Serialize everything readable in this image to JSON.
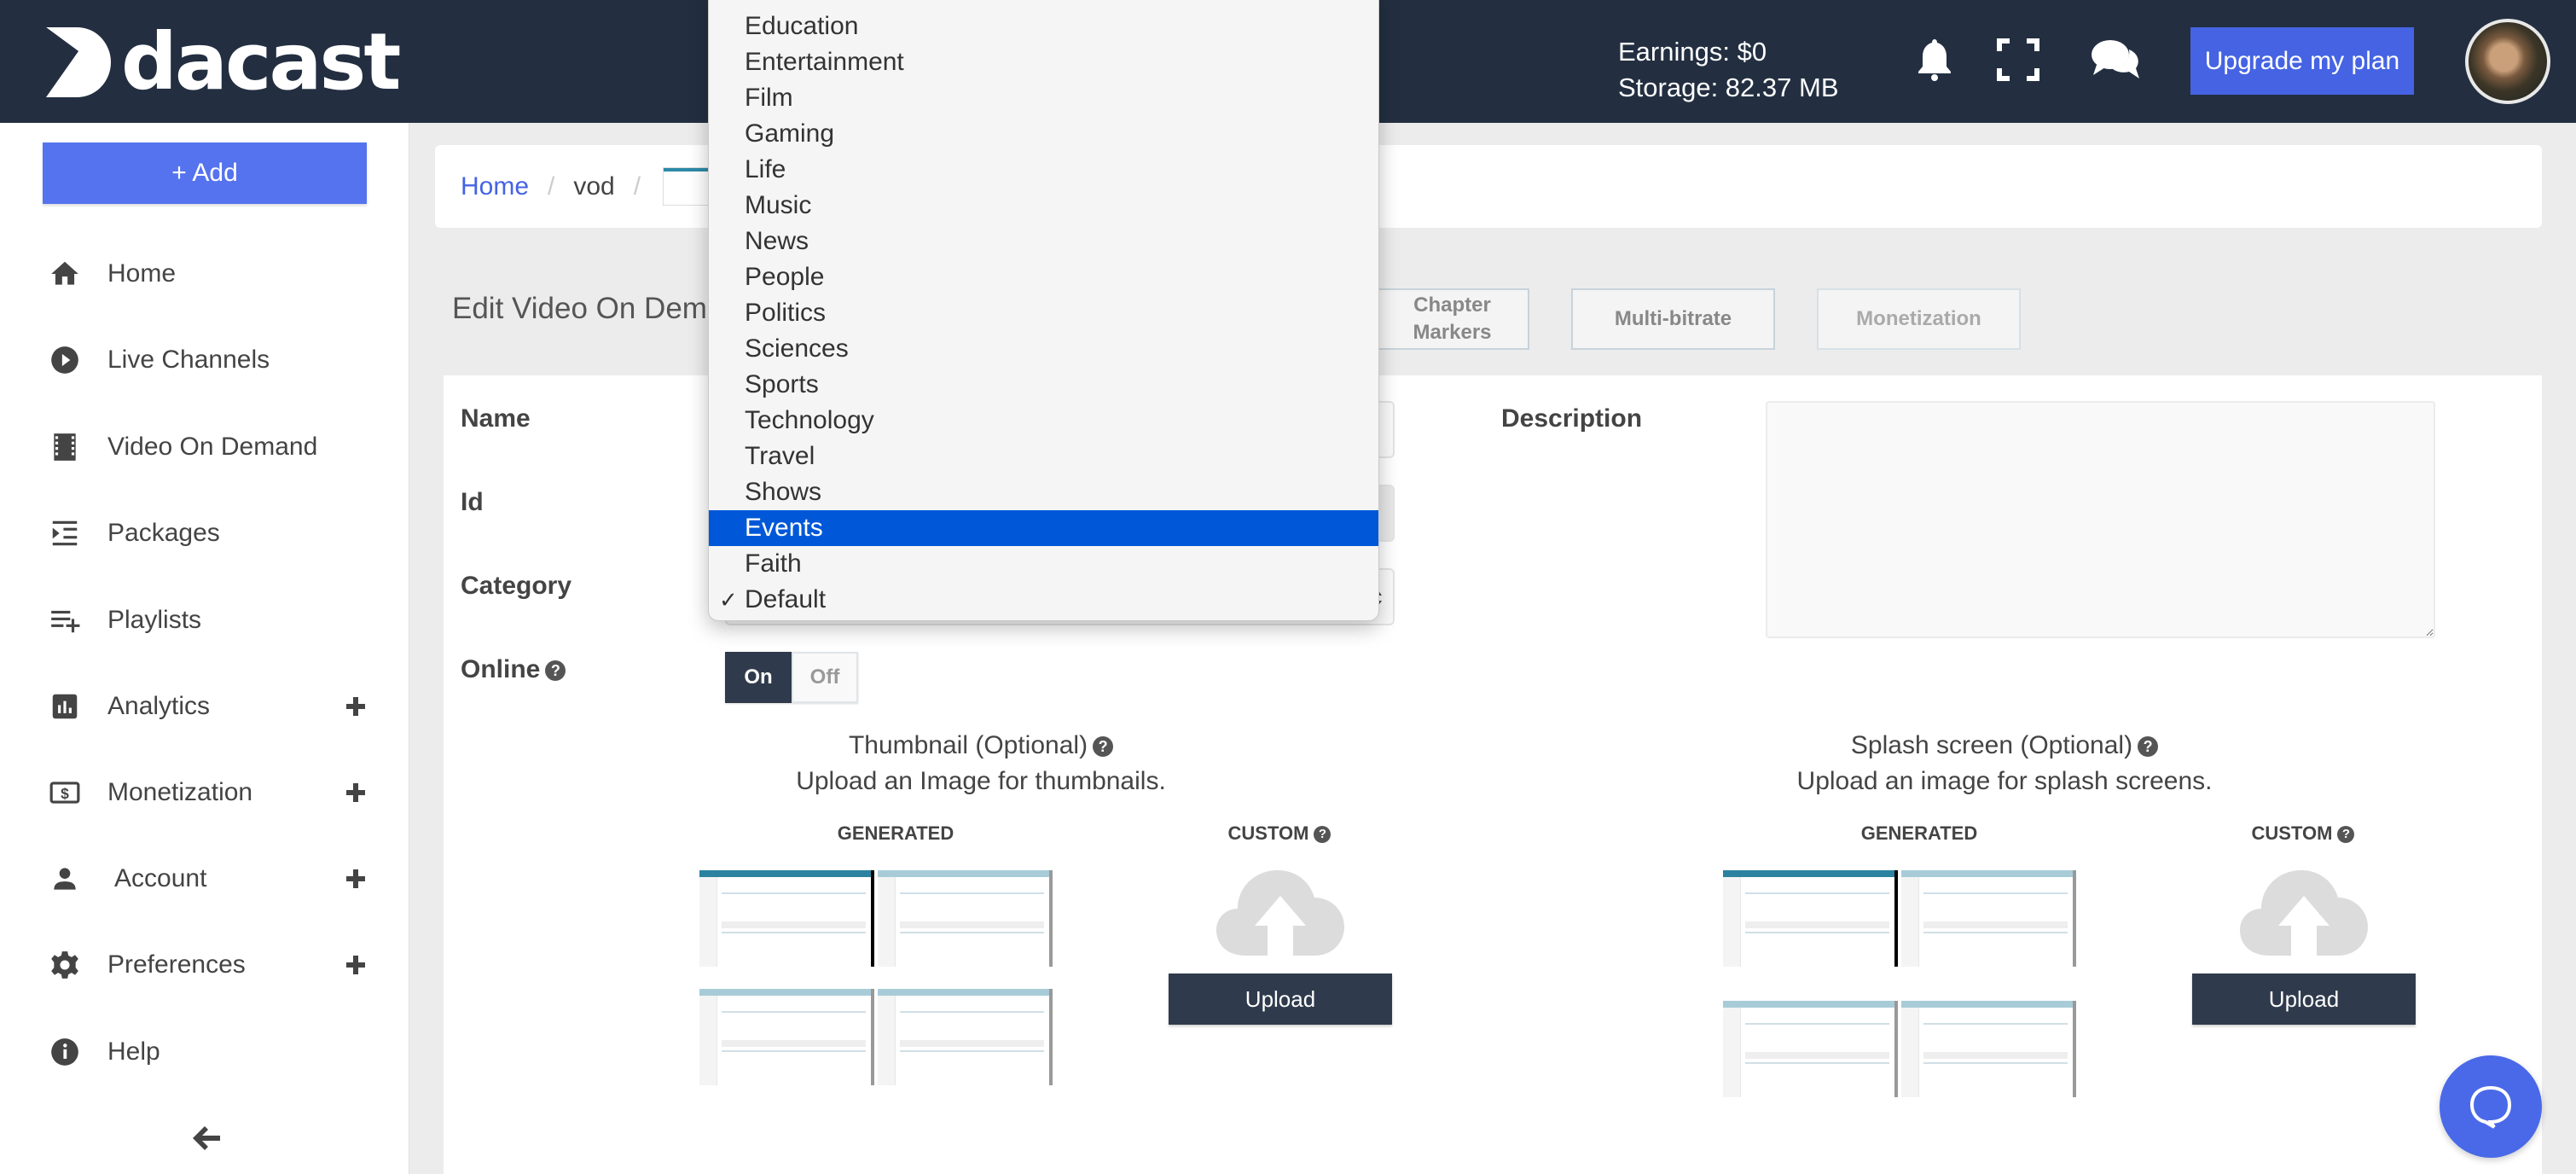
{
  "header": {
    "logo_text": "dacast",
    "earnings": "Earnings: $0",
    "storage": "Storage: 82.37 MB",
    "icons": [
      "bell-icon",
      "fullscreen-icon",
      "chat-icon"
    ],
    "upgrade_label": "Upgrade my plan",
    "colors": {
      "header_bg": "#232f41",
      "upgrade_bg": "#4563e3"
    }
  },
  "sidebar": {
    "add_label": "+ Add",
    "items": [
      {
        "label": "Home",
        "icon": "home-icon",
        "expandable": false
      },
      {
        "label": "Live Channels",
        "icon": "play-circle-icon",
        "expandable": false
      },
      {
        "label": "Video On Demand",
        "icon": "film-icon",
        "expandable": false
      },
      {
        "label": "Packages",
        "icon": "packages-icon",
        "expandable": false
      },
      {
        "label": "Playlists",
        "icon": "playlist-add-icon",
        "expandable": false
      },
      {
        "label": "Analytics",
        "icon": "bar-chart-icon",
        "expandable": true
      },
      {
        "label": "Monetization",
        "icon": "dollar-icon",
        "expandable": true
      },
      {
        "label": "Account",
        "icon": "person-icon",
        "expandable": true
      },
      {
        "label": "Preferences",
        "icon": "gear-icon",
        "expandable": true
      },
      {
        "label": "Help",
        "icon": "info-icon",
        "expandable": false
      }
    ],
    "collapse_icon": "arrow-left-icon"
  },
  "breadcrumb": {
    "home": "Home",
    "separator": "/",
    "vod": "vod"
  },
  "page": {
    "title": "Edit Video On Demand",
    "tabs": [
      {
        "label": "Chapter Markers",
        "state": "enabled"
      },
      {
        "label": "Multi-bitrate",
        "state": "enabled"
      },
      {
        "label": "Monetization",
        "state": "disabled"
      }
    ]
  },
  "form": {
    "name_label": "Name",
    "name_value": "",
    "id_label": "Id",
    "id_value": "",
    "category_label": "Category",
    "category_value": "Default",
    "online_label": "Online",
    "online_on": "On",
    "online_off": "Off",
    "online_state": "On",
    "description_label": "Description",
    "description_value": ""
  },
  "thumbnail": {
    "title": "Thumbnail (Optional)",
    "subtitle": "Upload an Image for thumbnails.",
    "generated_label": "GENERATED",
    "custom_label": "CUSTOM",
    "upload_label": "Upload"
  },
  "splash": {
    "title": "Splash screen (Optional)",
    "subtitle": "Upload an image for splash screens.",
    "generated_label": "GENERATED",
    "custom_label": "CUSTOM",
    "upload_label": "Upload"
  },
  "help_glyph": "?",
  "category_dropdown": {
    "options": [
      "Education",
      "Entertainment",
      "Film",
      "Gaming",
      "Life",
      "Music",
      "News",
      "People",
      "Politics",
      "Sciences",
      "Sports",
      "Technology",
      "Travel",
      "Shows",
      "Events",
      "Faith",
      "Default"
    ],
    "highlighted": "Events",
    "selected": "Default",
    "check_glyph": "✓",
    "highlight_color": "#0058d8"
  }
}
